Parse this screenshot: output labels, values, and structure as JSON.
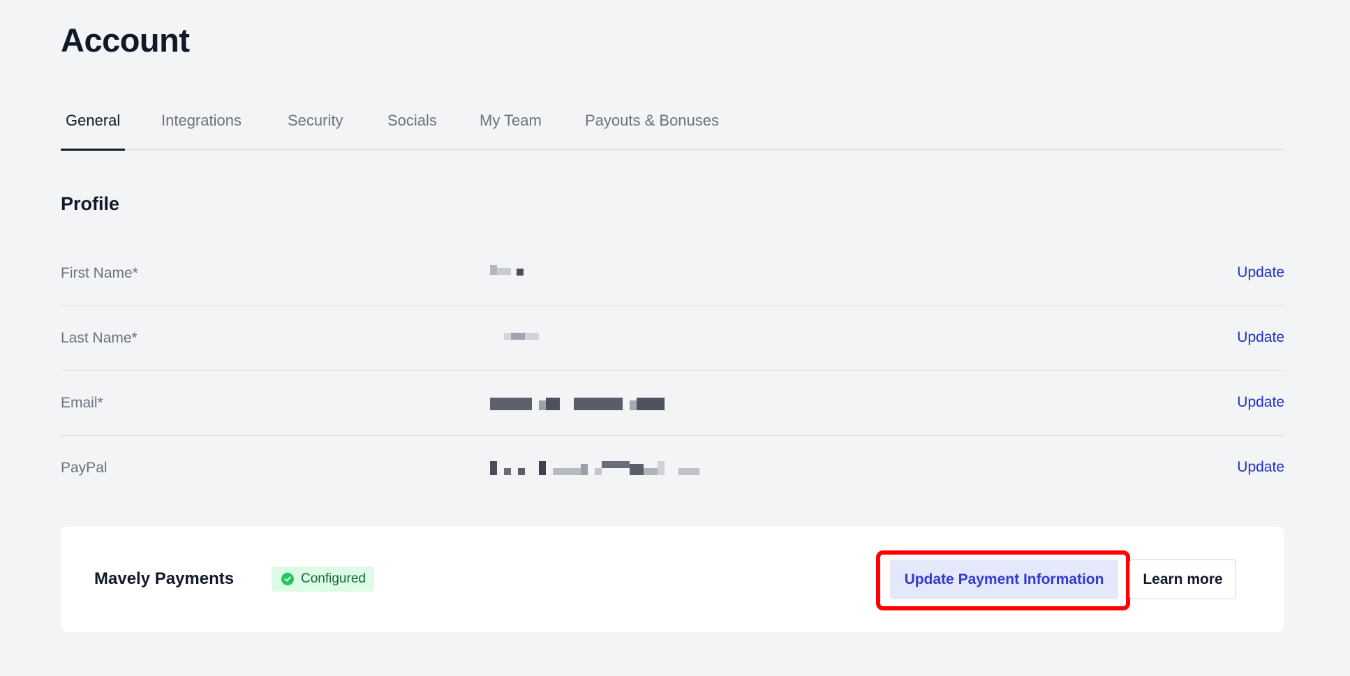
{
  "page": {
    "title": "Account"
  },
  "tabs": [
    {
      "label": "General",
      "active": true
    },
    {
      "label": "Integrations",
      "active": false
    },
    {
      "label": "Security",
      "active": false
    },
    {
      "label": "Socials",
      "active": false
    },
    {
      "label": "My Team",
      "active": false
    },
    {
      "label": "Payouts & Bonuses",
      "active": false
    }
  ],
  "profile": {
    "title": "Profile",
    "fields": [
      {
        "label": "First Name*",
        "value_state": "redacted",
        "action": "Update"
      },
      {
        "label": "Last Name*",
        "value_state": "redacted",
        "action": "Update"
      },
      {
        "label": "Email*",
        "value_state": "redacted",
        "action": "Update"
      },
      {
        "label": "PayPal",
        "value_state": "redacted",
        "action": "Update"
      }
    ]
  },
  "payments": {
    "title": "Mavely Payments",
    "status": "Configured",
    "status_icon": "check-circle-icon",
    "primary_action": "Update Payment Information",
    "secondary_action": "Learn more"
  },
  "colors": {
    "background": "#f3f4f6",
    "link": "#1d32c8",
    "primary_button_bg": "#e5e8fb",
    "primary_button_text": "#2e3ad0",
    "badge_bg": "#dcfce7",
    "badge_icon": "#22c55e",
    "highlight": "#ff0000"
  }
}
